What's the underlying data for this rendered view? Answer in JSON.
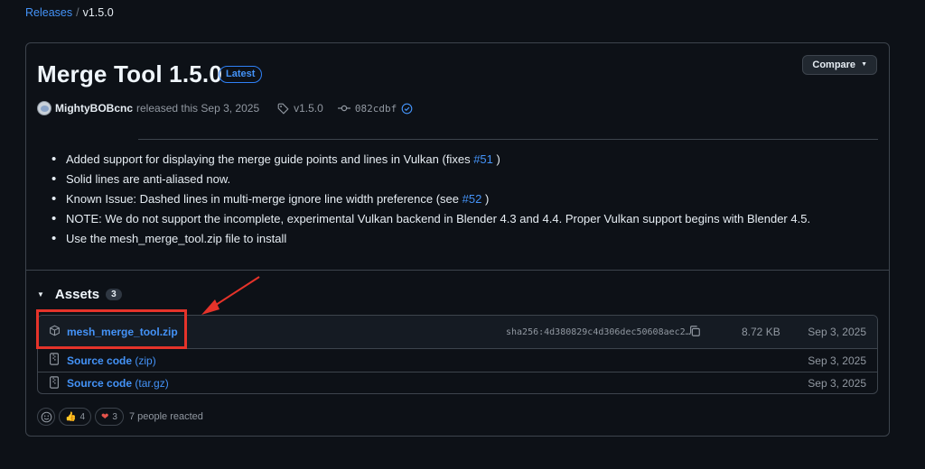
{
  "breadcrumb": {
    "releases": "Releases",
    "separator": "/",
    "current": "v1.5.0"
  },
  "release": {
    "title": "Merge Tool 1.5.0",
    "badge": "Latest",
    "compare_label": "Compare",
    "author": "MightyBOBcnc",
    "released_text": "released this Sep 3, 2025",
    "tag": "v1.5.0",
    "commit": "082cdbf"
  },
  "notes": [
    {
      "text": "Added support for displaying the merge guide points and lines in Vulkan (fixes ",
      "link": "#51",
      "after": " )"
    },
    {
      "text": "Solid lines are anti-aliased now.",
      "link": "",
      "after": ""
    },
    {
      "text": "Known Issue: Dashed lines in multi-merge ignore line width preference (see ",
      "link": "#52",
      "after": " )"
    },
    {
      "text": "NOTE: We do not support the incomplete, experimental Vulkan backend in Blender 4.3 and 4.4. Proper Vulkan support begins with Blender 4.5.",
      "link": "",
      "after": ""
    },
    {
      "text": "Use the mesh_merge_tool.zip file to install",
      "link": "",
      "after": ""
    }
  ],
  "assets": {
    "label": "Assets",
    "count": "3",
    "items": [
      {
        "name": "mesh_merge_tool.zip",
        "ext": "",
        "sha": "sha256:4d380829c4d306dec50608aec2…",
        "size": "8.72 KB",
        "date": "Sep 3, 2025",
        "icon": "package-icon"
      },
      {
        "name": "Source code",
        "ext": "(zip)",
        "sha": "",
        "size": "",
        "date": "Sep 3, 2025",
        "icon": "file-zip-icon"
      },
      {
        "name": "Source code",
        "ext": "(tar.gz)",
        "sha": "",
        "size": "",
        "date": "Sep 3, 2025",
        "icon": "file-zip-icon"
      }
    ]
  },
  "reactions": {
    "thumbs_up": "4",
    "heart": "3",
    "summary": "7 people reacted"
  },
  "colors": {
    "accent": "#4493f8",
    "annotation": "#e5332a",
    "background": "#0d1117"
  }
}
